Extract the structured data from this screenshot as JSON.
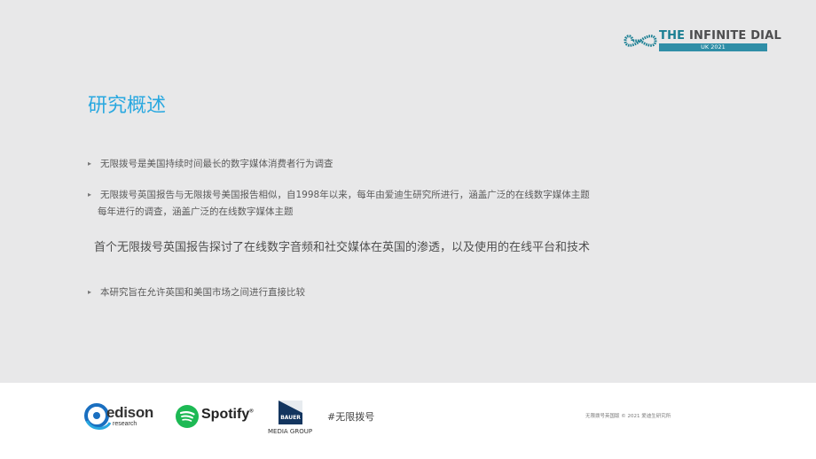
{
  "logo": {
    "title_part1": "THE ",
    "title_part2": "INFINITE DIAL",
    "subtitle": "UK 2021"
  },
  "slide": {
    "title": "研究概述",
    "bullet_marker": "▸",
    "bullets": [
      "无限拨号是美国持续时间最长的数字媒体消费者行为调查",
      "无限拨号英国报告与无限拨号美国报告相似，自1998年以来，每年由爱迪生研究所进行，涵盖广泛的在线数字媒体主题",
      "本研究旨在允许英国和美国市场之间进行直接比较"
    ],
    "bullet2_continued": "每年进行的调查，涵盖广泛的在线数字媒体主题",
    "highlight": "首个无限拨号英国报告探讨了在线数字音频和社交媒体在英国的渗透，以及使用的在线平台和技术"
  },
  "footer": {
    "edison_name": "edison",
    "edison_sub": "research",
    "spotify_name": "Spotify",
    "spotify_mark": "®",
    "bauer_box": "BAUER",
    "bauer_sub": "MEDIA GROUP",
    "hashtag": "#无限拨号",
    "copyright": "无限拨号英国版 © 2021 爱迪生研究所"
  },
  "colors": {
    "slide_bg": "#e8e8e9",
    "title": "#29a8e0",
    "logo_teal": "#1b7f93",
    "edison_blue": "#1a6fc0",
    "spotify_green": "#1db954",
    "bauer_navy": "#13355f"
  }
}
